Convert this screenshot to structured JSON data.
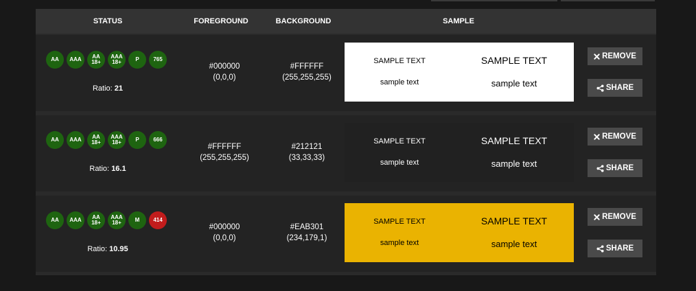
{
  "header": {
    "status": "STATUS",
    "foreground": "FOREGROUND",
    "background": "BACKGROUND",
    "sample": "SAMPLE"
  },
  "rows": [
    {
      "badges": [
        "AA",
        "AAA",
        "AA\n18+",
        "AAA\n18+",
        "P",
        "765"
      ],
      "badge_status": [
        "pass",
        "pass",
        "pass",
        "pass",
        "pass",
        "pass"
      ],
      "ratio_label": "Ratio:",
      "ratio_value": "21",
      "fg_hex": "#000000",
      "fg_rgb": "(0,0,0)",
      "bg_hex": "#FFFFFF",
      "bg_rgb": "(255,255,255)",
      "sample_fg": "#000000",
      "sample_bg": "#FFFFFF",
      "sample_upper": "SAMPLE TEXT",
      "sample_lower": "sample text",
      "remove_label": "REMOVE",
      "share_label": "SHARE"
    },
    {
      "badges": [
        "AA",
        "AAA",
        "AA\n18+",
        "AAA\n18+",
        "P",
        "666"
      ],
      "badge_status": [
        "pass",
        "pass",
        "pass",
        "pass",
        "pass",
        "pass"
      ],
      "ratio_label": "Ratio:",
      "ratio_value": "16.1",
      "fg_hex": "#FFFFFF",
      "fg_rgb": "(255,255,255)",
      "bg_hex": "#212121",
      "bg_rgb": "(33,33,33)",
      "sample_fg": "#FFFFFF",
      "sample_bg": "#212121",
      "sample_upper": "SAMPLE TEXT",
      "sample_lower": "sample text",
      "remove_label": "REMOVE",
      "share_label": "SHARE"
    },
    {
      "badges": [
        "AA",
        "AAA",
        "AA\n18+",
        "AAA\n18+",
        "M",
        "414"
      ],
      "badge_status": [
        "pass",
        "pass",
        "pass",
        "pass",
        "pass",
        "fail"
      ],
      "ratio_label": "Ratio:",
      "ratio_value": "10.95",
      "fg_hex": "#000000",
      "fg_rgb": "(0,0,0)",
      "bg_hex": "#EAB301",
      "bg_rgb": "(234,179,1)",
      "sample_fg": "#000000",
      "sample_bg": "#EAB301",
      "sample_upper": "SAMPLE TEXT",
      "sample_lower": "sample text",
      "remove_label": "REMOVE",
      "share_label": "SHARE"
    }
  ],
  "icons": {
    "remove": "close-icon",
    "share": "share-icon"
  },
  "colors": {
    "pass": "#1E6410",
    "fail": "#C21C1C",
    "button": "#4A4A4A"
  }
}
